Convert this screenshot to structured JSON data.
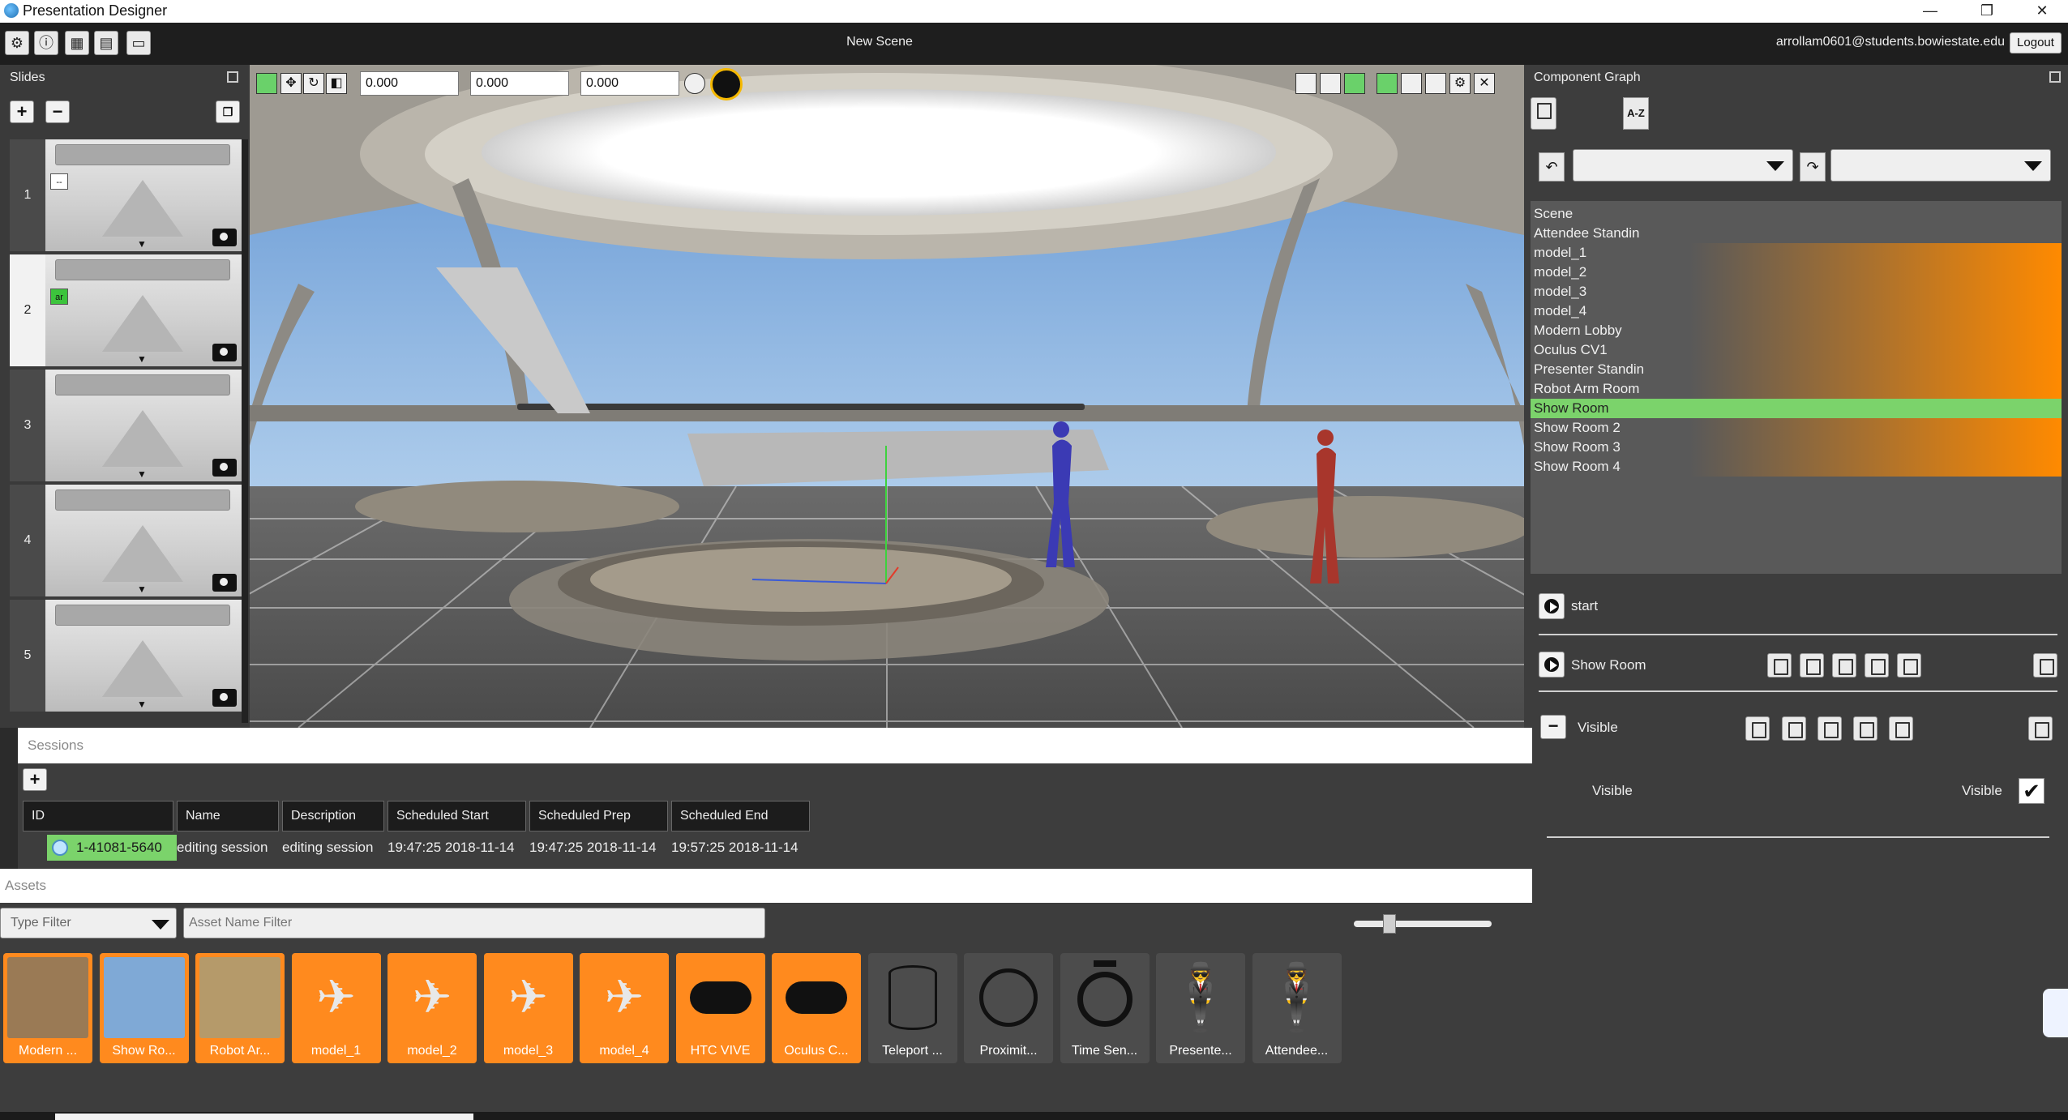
{
  "window": {
    "title": "Presentation Designer",
    "minimize": "—",
    "maximize": "❐",
    "close": "✕"
  },
  "toolbar": {
    "scene_title": "New Scene",
    "user_email": "arrollam0601@students.bowiestate.edu",
    "logout_label": "Logout"
  },
  "slides": {
    "title": "Slides",
    "add": "+",
    "remove": "−",
    "items": [
      {
        "number": "1",
        "tag": "--",
        "selected": false
      },
      {
        "number": "2",
        "tag": "ar",
        "selected": true
      },
      {
        "number": "3",
        "tag": "",
        "selected": false
      },
      {
        "number": "4",
        "tag": "",
        "selected": false
      },
      {
        "number": "5",
        "tag": "",
        "selected": false
      }
    ]
  },
  "viewport": {
    "x_value": "0.000",
    "y_value": "0.000",
    "z_value": "0.000"
  },
  "component_graph": {
    "title": "Component Graph",
    "sort_label": "A-Z",
    "items": [
      {
        "label": "Scene",
        "style": "plain"
      },
      {
        "label": "Attendee Standin",
        "style": "plain"
      },
      {
        "label": "model_1",
        "style": "orange"
      },
      {
        "label": "model_2",
        "style": "orange"
      },
      {
        "label": "model_3",
        "style": "orange"
      },
      {
        "label": "model_4",
        "style": "orange"
      },
      {
        "label": "Modern Lobby",
        "style": "orange"
      },
      {
        "label": "Oculus CV1",
        "style": "orange"
      },
      {
        "label": "Presenter Standin",
        "style": "orange"
      },
      {
        "label": "Robot Arm Room",
        "style": "orange"
      },
      {
        "label": "Show Room",
        "style": "selected"
      },
      {
        "label": "Show Room 2",
        "style": "orange"
      },
      {
        "label": "Show Room 3",
        "style": "orange"
      },
      {
        "label": "Show Room 4",
        "style": "orange"
      }
    ],
    "start_label": "start",
    "node_label": "Show Room",
    "component_label": "Visible",
    "property_label": "Visible",
    "property_name": "Visible",
    "collapse": "−"
  },
  "sessions": {
    "title": "Sessions",
    "add": "+",
    "columns": [
      "ID",
      "Name",
      "Description",
      "Scheduled Start",
      "Scheduled Prep",
      "Scheduled End"
    ],
    "rows": [
      {
        "id": "1-41081-5640",
        "name": "editing session",
        "description": "editing session",
        "start": "19:47:25 2018-11-14",
        "prep": "19:47:25 2018-11-14",
        "end": "19:57:25 2018-11-14"
      }
    ]
  },
  "assets": {
    "title": "Assets",
    "type_filter_placeholder": "Type Filter",
    "name_filter_placeholder": "Asset Name Filter",
    "items": [
      {
        "label": "Modern ...",
        "kind": "photo-lobby"
      },
      {
        "label": "Show Ro...",
        "kind": "photo-room"
      },
      {
        "label": "Robot Ar...",
        "kind": "photo-robot"
      },
      {
        "label": "model_1",
        "kind": "plane"
      },
      {
        "label": "model_2",
        "kind": "plane"
      },
      {
        "label": "model_3",
        "kind": "plane"
      },
      {
        "label": "model_4",
        "kind": "plane"
      },
      {
        "label": "HTC VIVE",
        "kind": "headset"
      },
      {
        "label": "Oculus C...",
        "kind": "headset"
      },
      {
        "label": "Teleport ...",
        "kind": "teleport"
      },
      {
        "label": "Proximit...",
        "kind": "proximity"
      },
      {
        "label": "Time Sen...",
        "kind": "timer"
      },
      {
        "label": "Presente...",
        "kind": "person"
      },
      {
        "label": "Attendee...",
        "kind": "person"
      }
    ]
  }
}
